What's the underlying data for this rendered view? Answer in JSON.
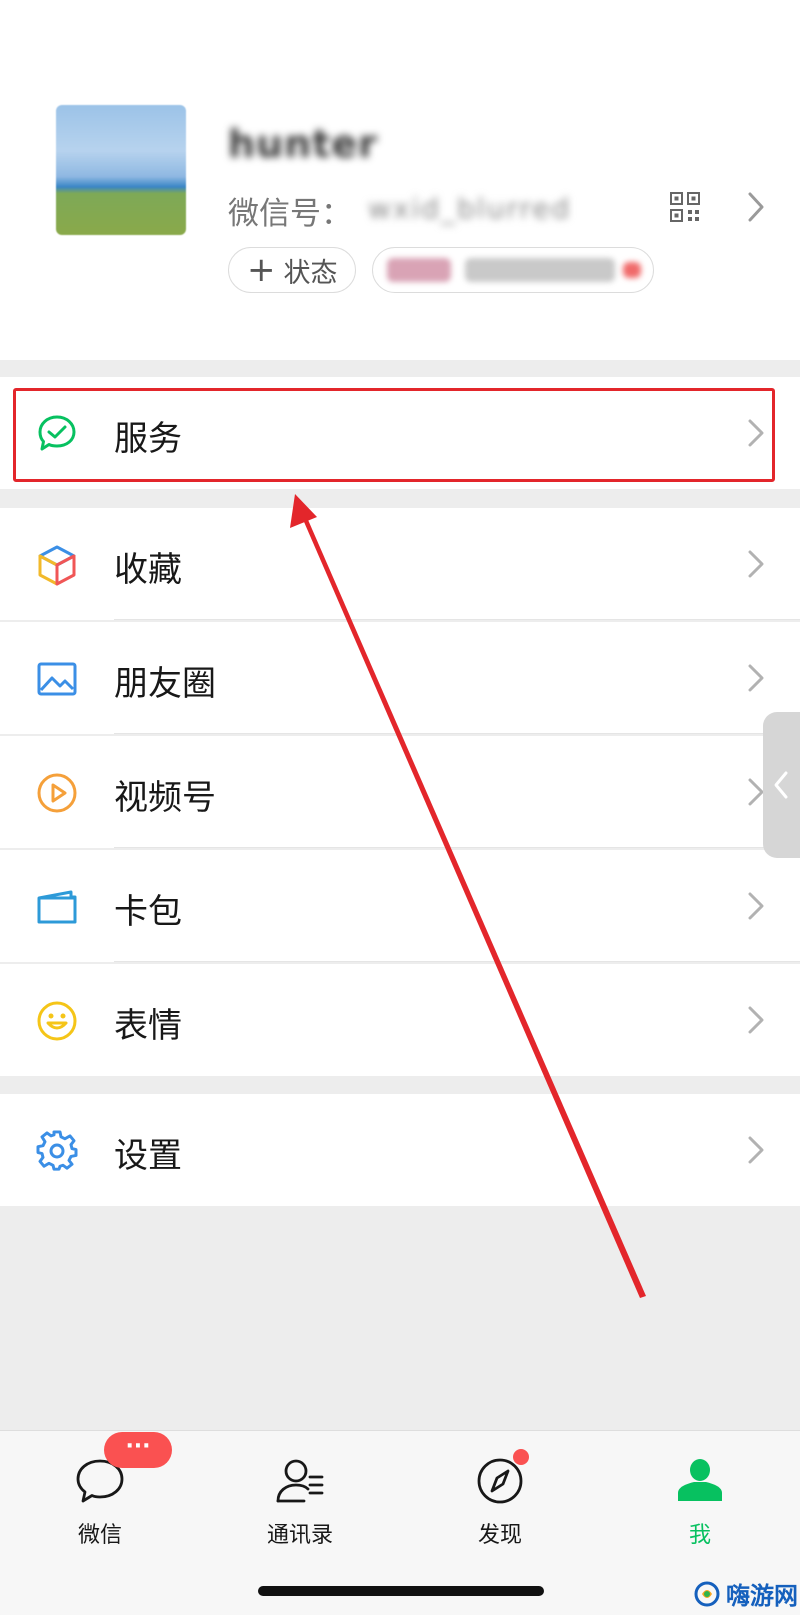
{
  "profile": {
    "nickname": "hunter",
    "wechat_id_label": "微信号：",
    "wechat_id_value": "wxid_blurred",
    "status_button": "状态",
    "friends_status_text": ""
  },
  "menu": {
    "services": "服务",
    "favorites": "收藏",
    "moments": "朋友圈",
    "channels": "视频号",
    "cards": "卡包",
    "stickers": "表情",
    "settings": "设置"
  },
  "tabbar": {
    "chats": "微信",
    "contacts": "通讯录",
    "discover": "发现",
    "me": "我",
    "chats_badge": "···"
  },
  "watermark": "嗨游网",
  "colors": {
    "accent_green": "#07c160",
    "highlight_red": "#e3262b",
    "badge_red": "#fa5151",
    "page_bg": "#ededed"
  },
  "icons": {
    "services": "services-icon",
    "favorites": "favorites-cube-icon",
    "moments": "moments-picture-icon",
    "channels": "channels-play-icon",
    "cards": "card-wallet-icon",
    "stickers": "smiley-icon",
    "settings": "gear-icon"
  }
}
